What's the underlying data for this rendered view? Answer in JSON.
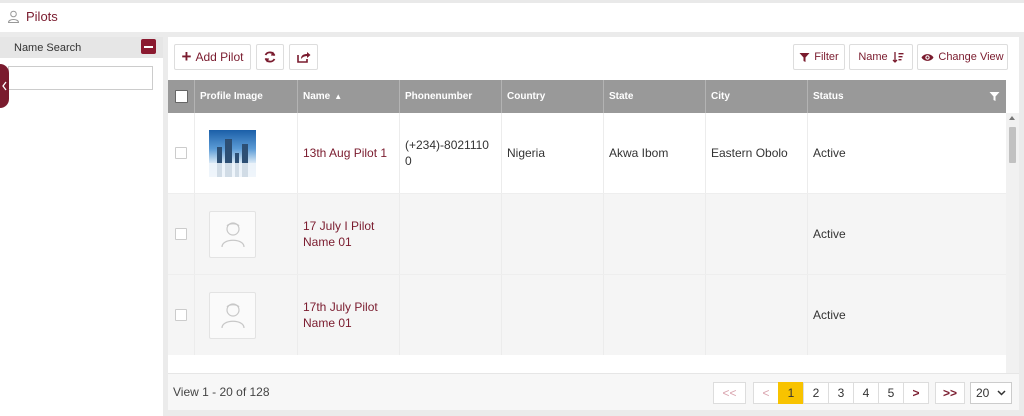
{
  "header": {
    "title": "Pilots",
    "icon": "user-icon"
  },
  "sidebar": {
    "search_title": "Name Search",
    "search_value": ""
  },
  "toolbar": {
    "add_label": "Add Pilot",
    "filter_label": "Filter",
    "sort_label": "Name",
    "change_view_label": "Change View"
  },
  "grid": {
    "columns": [
      "Profile Image",
      "Name",
      "Phonenumber",
      "Country",
      "State",
      "City",
      "Status"
    ],
    "sorted_column": "Name",
    "rows": [
      {
        "image": "photo",
        "name": "13th Aug Pilot 1",
        "phone": "(+234)-8021110\n0",
        "country": "Nigeria",
        "state": "Akwa Ibom",
        "city": "Eastern Obolo",
        "status": "Active"
      },
      {
        "image": "placeholder",
        "name": "17 July I Pilot Name 01",
        "phone": "",
        "country": "",
        "state": "",
        "city": "",
        "status": "Active"
      },
      {
        "image": "placeholder",
        "name": "17th July Pilot Name 01",
        "phone": "",
        "country": "",
        "state": "",
        "city": "",
        "status": "Active"
      }
    ]
  },
  "footer": {
    "info": "View 1 - 20 of 128",
    "pages": [
      "1",
      "2",
      "3",
      "4",
      "5"
    ],
    "current_page": "1",
    "first": "<<",
    "prev": "<",
    "next": ">",
    "last": ">>",
    "page_size": "20"
  },
  "colors": {
    "accent": "#7a1b2e",
    "active_page": "#f8c300",
    "header_bg": "#999999"
  }
}
